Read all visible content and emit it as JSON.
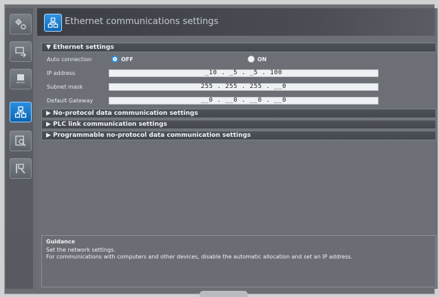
{
  "window": {
    "title": "Ethernet communications settings"
  },
  "sidebar": {
    "items": [
      {
        "icon": "network-settings-icon",
        "active": false
      },
      {
        "icon": "transfer-icon",
        "active": false
      },
      {
        "icon": "memory-card-icon",
        "active": false
      },
      {
        "icon": "ethernet-icon",
        "active": true
      },
      {
        "icon": "document-search-icon",
        "active": false
      },
      {
        "icon": "status-monitor-icon",
        "active": false
      }
    ]
  },
  "sections": {
    "ethernet": {
      "label": "Ethernet settings",
      "expanded": true,
      "auto_connection": {
        "label": "Auto connection",
        "options": [
          "OFF",
          "ON"
        ],
        "selected": "OFF"
      },
      "ip_address": {
        "label": "IP address",
        "value": "_10 . _5 . _5 . 100"
      },
      "subnet_mask": {
        "label": "Subnet mask",
        "value": "255 . 255 . 255 . __0"
      },
      "default_gateway": {
        "label": "Default Gateway",
        "value": "__0 . __0 . __0 . __0"
      }
    },
    "no_protocol": {
      "label": "No-protocol data communication settings",
      "expanded": false
    },
    "plc_link": {
      "label": "PLC link communication settings",
      "expanded": false
    },
    "programmable": {
      "label": "Programmable no-protocol data communication settings",
      "expanded": false
    }
  },
  "guidance": {
    "title": "Guidance",
    "line1": "Set the network settings.",
    "line2": "For communications with computers and other devices, disable the automatic allocation and set an IP address."
  },
  "colors": {
    "accent": "#1a7fd6",
    "background": "#6c7076"
  }
}
